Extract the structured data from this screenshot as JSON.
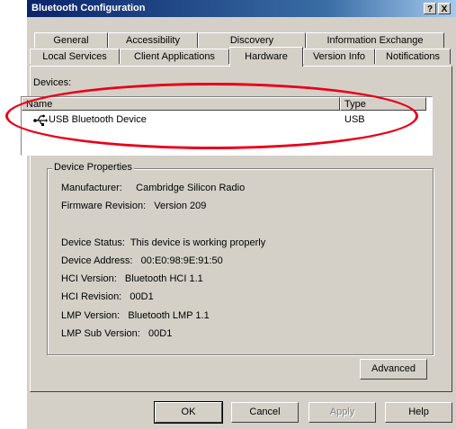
{
  "window": {
    "title": "Bluetooth Configuration"
  },
  "title_buttons": {
    "help": "?",
    "close": "X"
  },
  "tabs_row1": [
    "General",
    "Accessibility",
    "Discovery",
    "Information Exchange"
  ],
  "tabs_row2": [
    "Local Services",
    "Client Applications",
    "Hardware",
    "Version Info",
    "Notifications"
  ],
  "active_tab": "Hardware",
  "devices": {
    "label": "Devices:",
    "columns": [
      "Name",
      "Type"
    ],
    "rows": [
      {
        "name": "USB Bluetooth Device",
        "type": "USB",
        "icon": "usb-icon"
      }
    ]
  },
  "properties": {
    "caption": "Device Properties",
    "manufacturer": "Manufacturer:     Cambridge Silicon Radio",
    "firmware": "Firmware Revision:   Version 209",
    "status": "Device Status:  This device is working properly",
    "address": "Device Address:   00:E0:98:9E:91:50",
    "hci_version": "HCI Version:   Bluetooth HCI 1.1",
    "hci_revision": "HCI Revision:   00D1",
    "lmp_version": "LMP Version:   Bluetooth LMP 1.1",
    "lmp_sub": "LMP Sub Version:   00D1"
  },
  "buttons": {
    "advanced": "Advanced",
    "ok": "OK",
    "cancel": "Cancel",
    "apply": "Apply",
    "help": "Help"
  },
  "annotation": {
    "color": "#e8001a"
  }
}
